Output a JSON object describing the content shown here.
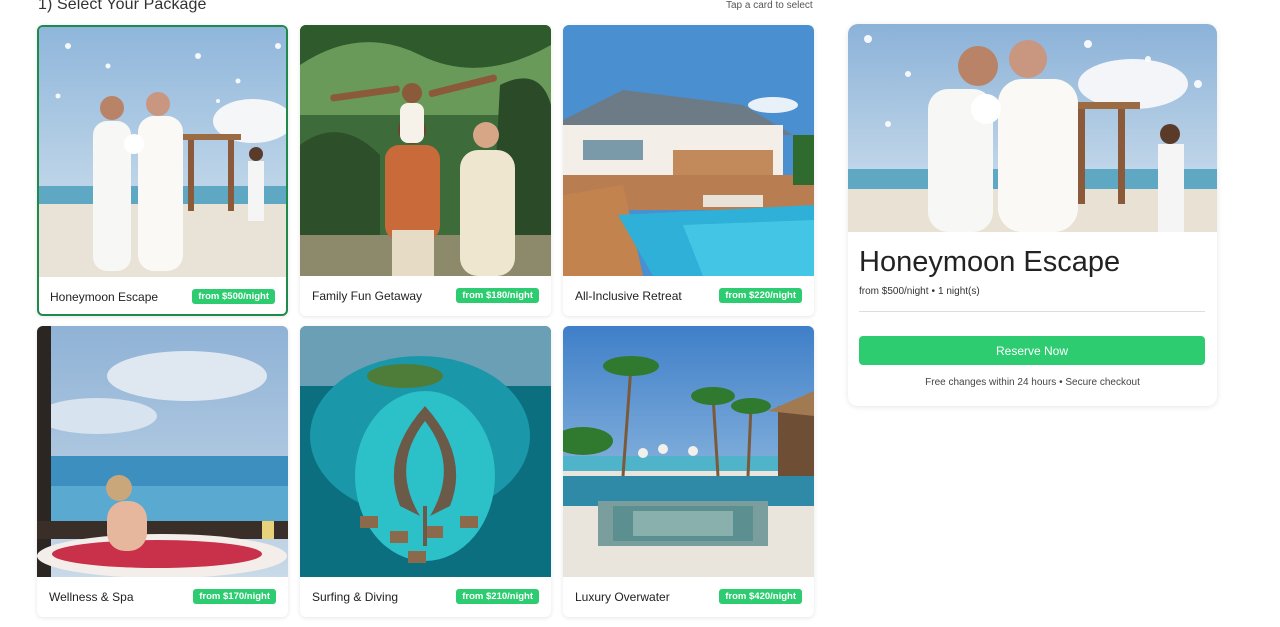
{
  "section": {
    "title": "1) Select Your Package",
    "hint": "Tap a card to select"
  },
  "packages": [
    {
      "name": "Honeymoon Escape",
      "price": "from $500/night",
      "selected": true,
      "image": "honeymoon-beach-couple"
    },
    {
      "name": "Family Fun Getaway",
      "price": "from $180/night",
      "selected": false,
      "image": "family-palms"
    },
    {
      "name": "All-Inclusive Retreat",
      "price": "from $220/night",
      "selected": false,
      "image": "villa-pool"
    },
    {
      "name": "Wellness & Spa",
      "price": "from $170/night",
      "selected": false,
      "image": "spa-bath-ocean"
    },
    {
      "name": "Surfing & Diving",
      "price": "from $210/night",
      "selected": false,
      "image": "atoll-overwater"
    },
    {
      "name": "Luxury Overwater",
      "price": "from $420/night",
      "selected": false,
      "image": "beach-pool-palms"
    }
  ],
  "summary": {
    "title": "Honeymoon Escape",
    "price": "from $500/night",
    "separator": "•",
    "nights": "1 night(s)",
    "reserve_label": "Reserve Now",
    "note": "Free changes within 24 hours • Secure checkout"
  },
  "colors": {
    "accent": "#2ecc71",
    "selected_border": "#1f8a4c"
  }
}
